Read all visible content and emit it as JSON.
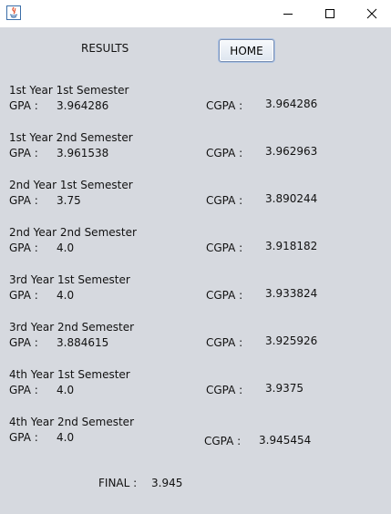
{
  "window": {
    "minimize_glyph": "—",
    "maximize_glyph": "☐",
    "close_glyph": "✕"
  },
  "header": {
    "title": "RESULTS",
    "home_label": "HOME"
  },
  "labels": {
    "gpa": "GPA :",
    "cgpa": "CGPA :"
  },
  "semesters": [
    {
      "name": "1st Year 1st Semester",
      "gpa": "3.964286",
      "cgpa": "3.964286"
    },
    {
      "name": "1st Year 2nd Semester",
      "gpa": "3.961538",
      "cgpa": "3.962963"
    },
    {
      "name": "2nd Year 1st Semester",
      "gpa": "3.75",
      "cgpa": "3.890244"
    },
    {
      "name": "2nd Year 2nd Semester",
      "gpa": "4.0",
      "cgpa": "3.918182"
    },
    {
      "name": "3rd Year 1st Semester",
      "gpa": "4.0",
      "cgpa": "3.933824"
    },
    {
      "name": "3rd Year 2nd Semester",
      "gpa": "3.884615",
      "cgpa": "3.925926"
    },
    {
      "name": "4th Year 1st Semester",
      "gpa": "4.0",
      "cgpa": "3.9375"
    },
    {
      "name": "4th Year 2nd Semester",
      "gpa": "4.0",
      "cgpa": "3.945454"
    }
  ],
  "final": {
    "label": "FINAL :",
    "value": "3.945"
  },
  "colors": {
    "background": "#d6d9df",
    "titlebar": "#ffffff"
  }
}
